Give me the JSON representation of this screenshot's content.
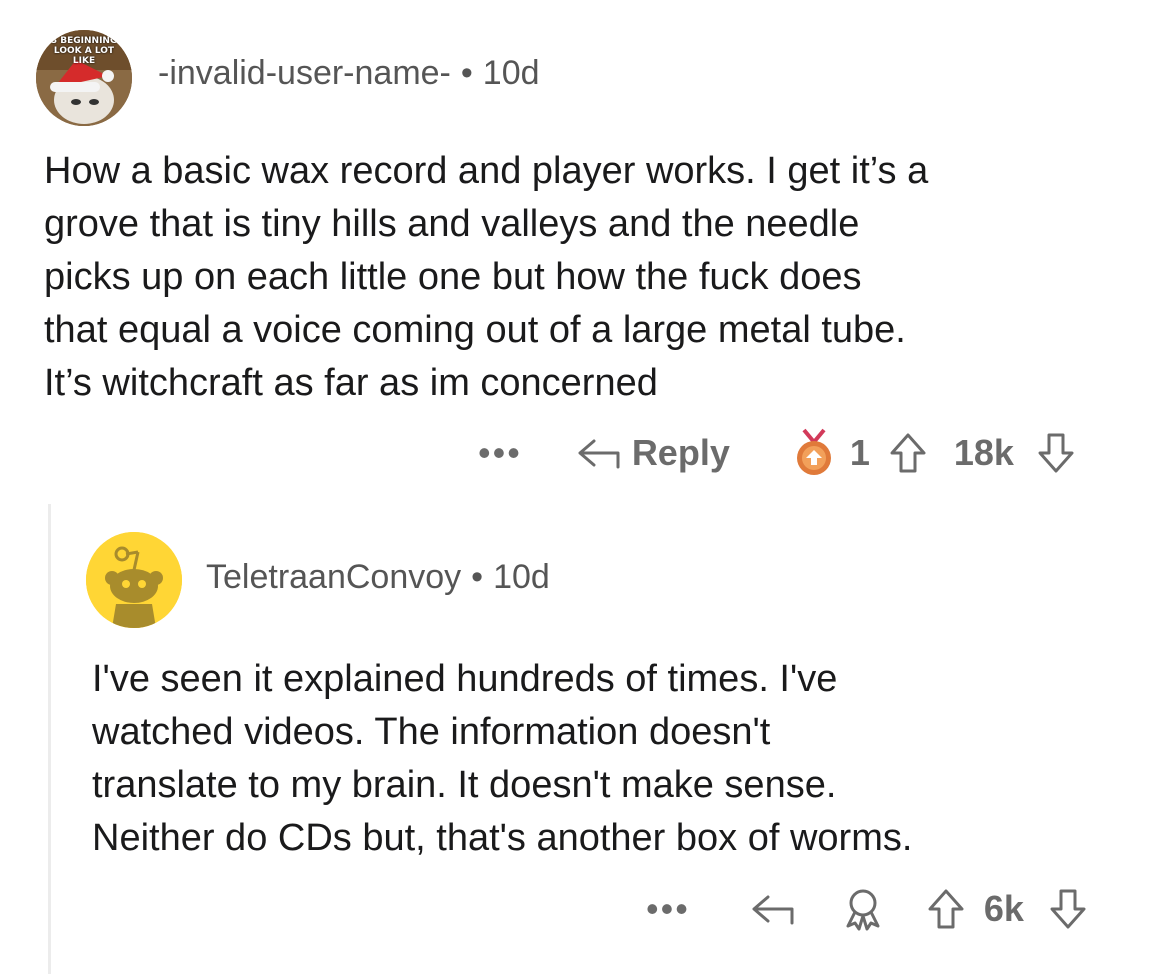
{
  "comment1": {
    "avatar": {
      "caption": "S BEGINNING\nLOOK A LOT LIKE"
    },
    "username": "-invalid-user-name-",
    "separator": "•",
    "age": "10d",
    "text": "How a basic wax record and player works. I get it’s a\ngrove that is tiny hills and valleys and the needle\npicks up on each little one but how the fuck does\nthat equal a voice coming out of a large metal tube.\nIt’s witchcraft as far as im concerned",
    "actions": {
      "more": "•••",
      "reply_label": "Reply",
      "award_count": "1",
      "vote_count": "18k"
    }
  },
  "comment2": {
    "username": "TeletraanConvoy",
    "separator": "•",
    "age": "10d",
    "text": "I've seen it explained hundreds of times.  I've\nwatched videos.  The information doesn't\ntranslate to my brain.  It doesn't make sense.\nNeither do CDs but, that's another box of worms.",
    "actions": {
      "more": "•••",
      "vote_count": "6k"
    }
  },
  "colors": {
    "text": "#1a1a1b",
    "meta": "#555555",
    "action": "#6b6b6b",
    "snoo_bg": "#ffd635",
    "award": "#e07a3a"
  },
  "icons": [
    "reply-arrow-icon",
    "award-medal-icon",
    "upvote-arrow-icon",
    "downvote-arrow-icon",
    "award-ribbon-icon",
    "snoo-avatar-icon"
  ]
}
